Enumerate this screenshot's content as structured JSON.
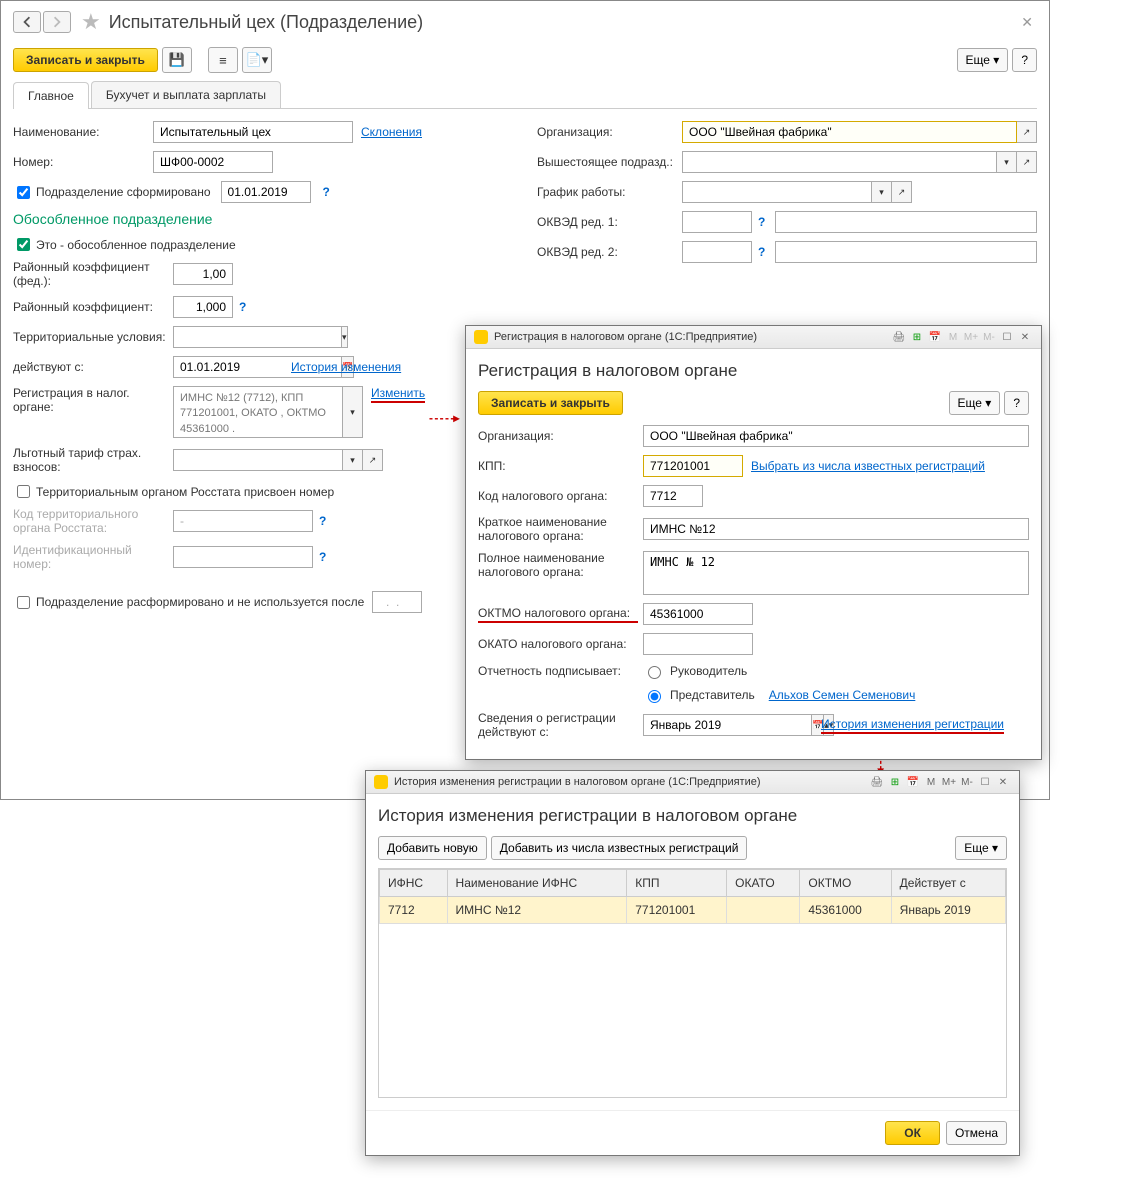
{
  "main": {
    "title": "Испытательный цех (Подразделение)",
    "btn_save_close": "Записать и закрыть",
    "btn_more": "Еще",
    "btn_help": "?",
    "tabs": {
      "main": "Главное",
      "accounting": "Бухучет и выплата зарплаты"
    },
    "left": {
      "name_label": "Наименование:",
      "name_value": "Испытательный цех",
      "decl_link": "Склонения",
      "num_label": "Номер:",
      "num_value": "ШФ00-0002",
      "formed_chk": "Подразделение сформировано",
      "formed_date": "01.01.2019",
      "sep_title": "Обособленное подразделение",
      "sep_chk": "Это - обособленное подразделение",
      "rk_fed_label": "Районный коэффициент (фед.):",
      "rk_fed_val": "1,00",
      "rk_label": "Районный коэффициент:",
      "rk_val": "1,000",
      "terr_label": "Территориальные условия:",
      "eff_from_label": "действуют с:",
      "eff_from_val": "01.01.2019",
      "hist_link": "История изменения",
      "reg_label": "Регистрация в налог. органе:",
      "reg_text": "ИМНС №12 (7712), КПП 771201001, ОКАТО , ОКТМО 45361000  .",
      "change_link": "Изменить",
      "benefit_label": "Льготный тариф страх. взносов:",
      "rosstat_chk": "Территориальным органом Росстата присвоен номер",
      "rosstat_code_label": "Код территориального органа Росстата:",
      "rosstat_code_val": "-",
      "ident_label": "Идентификационный номер:",
      "disband_chk": "Подразделение расформировано и не используется после",
      "disband_val": "  .  ."
    },
    "right": {
      "org_label": "Организация:",
      "org_val": "ООО \"Швейная фабрика\"",
      "parent_label": "Вышестоящее подразд.:",
      "sched_label": "График работы:",
      "okved1_label": "ОКВЭД ред. 1:",
      "okved2_label": "ОКВЭД ред. 2:"
    }
  },
  "dlg1": {
    "titlebar": "Регистрация в налоговом органе  (1С:Предприятие)",
    "heading": "Регистрация в налоговом органе",
    "btn_save_close": "Записать и закрыть",
    "btn_more": "Еще",
    "btn_help": "?",
    "org_label": "Организация:",
    "org_val": "ООО \"Швейная фабрика\"",
    "kpp_label": "КПП:",
    "kpp_val": "771201001",
    "select_known_link": "Выбрать из числа известных регистраций",
    "code_label": "Код налогового органа:",
    "code_val": "7712",
    "short_label": "Краткое наименование налогового органа:",
    "short_val": "ИМНС №12",
    "full_label": "Полное наименование налогового органа:",
    "full_val": "ИМНС № 12",
    "oktmo_label": "ОКТМО налогового органа:",
    "oktmo_val": "45361000",
    "okato_label": "ОКАТО налогового органа:",
    "sign_label": "Отчетность подписывает:",
    "sign_r1": "Руководитель",
    "sign_r2": "Представитель",
    "rep_link": "Альхов Семен Семенович",
    "eff_label": "Сведения о регистрации действуют с:",
    "eff_val": "Январь 2019",
    "hist_link": "История изменения регистрации"
  },
  "dlg2": {
    "titlebar": "История изменения регистрации в налоговом органе  (1С:Предприятие)",
    "heading": "История изменения регистрации в налоговом органе",
    "btn_add": "Добавить новую",
    "btn_add_known": "Добавить из числа известных регистраций",
    "btn_more": "Еще",
    "cols": {
      "ifns": "ИФНС",
      "name": "Наименование ИФНС",
      "kpp": "КПП",
      "okato": "ОКАТО",
      "oktmo": "ОКТМО",
      "eff": "Действует с"
    },
    "row": {
      "ifns": "7712",
      "name": "ИМНС №12",
      "kpp": "771201001",
      "okato": "",
      "oktmo": "45361000",
      "eff": "Январь 2019"
    },
    "btn_ok": "ОК",
    "btn_cancel": "Отмена"
  }
}
